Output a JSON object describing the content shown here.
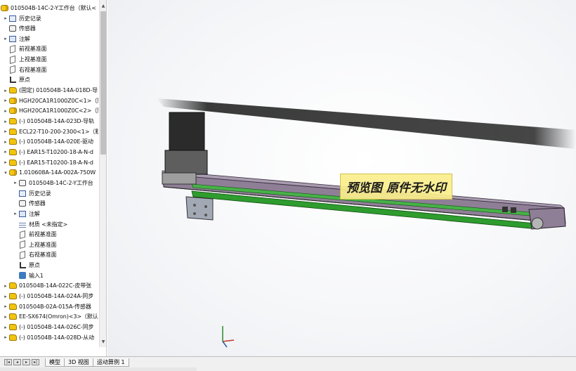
{
  "tree": {
    "root": "010504B-14C-2-Y工作台（默认<",
    "items": [
      {
        "label": "历史记录",
        "icon": "history-icon",
        "kind": "hist",
        "arrow": "▸",
        "indent": 0
      },
      {
        "label": "传感器",
        "icon": "sensor-icon",
        "kind": "sensor",
        "arrow": "",
        "indent": 0
      },
      {
        "label": "注解",
        "icon": "annotation-icon",
        "kind": "note",
        "arrow": "▸",
        "indent": 0
      },
      {
        "label": "前视基准面",
        "icon": "plane-icon",
        "kind": "plane",
        "arrow": "",
        "indent": 0
      },
      {
        "label": "上视基准面",
        "icon": "plane-icon",
        "kind": "plane",
        "arrow": "",
        "indent": 0
      },
      {
        "label": "右视基准面",
        "icon": "plane-icon",
        "kind": "plane",
        "arrow": "",
        "indent": 0
      },
      {
        "label": "原点",
        "icon": "origin-icon",
        "kind": "origin",
        "arrow": "",
        "indent": 0
      },
      {
        "label": "(固定) 010504B-14A-018D-导",
        "icon": "part-icon",
        "kind": "part",
        "arrow": "▸",
        "indent": 0
      },
      {
        "label": "HGH20CA1R1000Z0C<1>（默",
        "icon": "assembly-icon",
        "kind": "asm",
        "arrow": "▸",
        "indent": 0
      },
      {
        "label": "HGH20CA1R1000Z0C<2>（默",
        "icon": "assembly-icon",
        "kind": "asm",
        "arrow": "▸",
        "indent": 0
      },
      {
        "label": "(-) 010504B-14A-023D-导轨",
        "icon": "part-icon",
        "kind": "part",
        "arrow": "▸",
        "indent": 0
      },
      {
        "label": "ECL22-T10-200-2300<1>（默",
        "icon": "part-icon",
        "kind": "part",
        "arrow": "▸",
        "indent": 0
      },
      {
        "label": "(-) 010504B-14A-020E-驱动",
        "icon": "part-icon",
        "kind": "part",
        "arrow": "▸",
        "indent": 0
      },
      {
        "label": "(-) EAR15-T10200-18-A-N-d",
        "icon": "part-icon",
        "kind": "part",
        "arrow": "▸",
        "indent": 0
      },
      {
        "label": "(-) EAR15-T10200-18-A-N-d",
        "icon": "part-icon",
        "kind": "part",
        "arrow": "▸",
        "indent": 0
      },
      {
        "label": "1.010608A-14A-002A-750W",
        "icon": "assembly-icon",
        "kind": "asm",
        "arrow": "▾",
        "indent": 0
      },
      {
        "label": "010504B-14C-2-Y工作台",
        "icon": "sensor-icon",
        "kind": "sensor",
        "arrow": "▸",
        "indent": 1
      },
      {
        "label": "历史记录",
        "icon": "history-icon",
        "kind": "hist",
        "arrow": "",
        "indent": 1
      },
      {
        "label": "传感器",
        "icon": "sensor-icon",
        "kind": "sensor",
        "arrow": "",
        "indent": 1
      },
      {
        "label": "注解",
        "icon": "annotation-icon",
        "kind": "note",
        "arrow": "▸",
        "indent": 1
      },
      {
        "label": "材质 <未指定>",
        "icon": "material-icon",
        "kind": "mat",
        "arrow": "",
        "indent": 1
      },
      {
        "label": "前视基准面",
        "icon": "plane-icon",
        "kind": "plane",
        "arrow": "",
        "indent": 1
      },
      {
        "label": "上视基准面",
        "icon": "plane-icon",
        "kind": "plane",
        "arrow": "",
        "indent": 1
      },
      {
        "label": "右视基准面",
        "icon": "plane-icon",
        "kind": "plane",
        "arrow": "",
        "indent": 1
      },
      {
        "label": "原点",
        "icon": "origin-icon",
        "kind": "origin",
        "arrow": "",
        "indent": 1
      },
      {
        "label": "输入1",
        "icon": "input-icon",
        "kind": "input",
        "arrow": "",
        "indent": 1
      },
      {
        "label": "010504B-14A-022C-皮带张",
        "icon": "part-icon",
        "kind": "part",
        "arrow": "▸",
        "indent": 0
      },
      {
        "label": "(-) 010504B-14A-024A-同步",
        "icon": "part-icon",
        "kind": "part",
        "arrow": "▸",
        "indent": 0
      },
      {
        "label": "010504B-02A-015A-传感器",
        "icon": "part-icon",
        "kind": "part",
        "arrow": "▸",
        "indent": 0
      },
      {
        "label": "EE-SX674(Omron)<3>（默认",
        "icon": "part-icon",
        "kind": "part",
        "arrow": "▸",
        "indent": 0
      },
      {
        "label": "(-) 010504B-14A-026C-同步",
        "icon": "part-icon",
        "kind": "part",
        "arrow": "▸",
        "indent": 0
      },
      {
        "label": "(-) 010504B-14A-028D-从动",
        "icon": "part-icon",
        "kind": "part",
        "arrow": "▸",
        "indent": 0
      }
    ]
  },
  "tabs": {
    "model": "模型",
    "view3d": "3D 视图",
    "motion": "运动算例 1"
  },
  "viewport": {
    "watermark": "预览图 原件无水印"
  }
}
